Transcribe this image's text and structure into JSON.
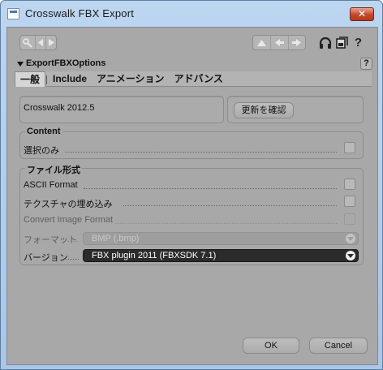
{
  "window": {
    "title": "Crosswalk FBX Export",
    "close_glyph": "✕"
  },
  "toolbar": {
    "left_icons": [
      "wrench-icon",
      "arrow-left-icon",
      "arrow-right-icon"
    ],
    "right_icons": [
      "move-up-icon",
      "move-left-icon",
      "move-right-icon",
      "headphones-icon",
      "copy-icon",
      "help-icon"
    ],
    "help_glyph": "?"
  },
  "section": {
    "title": "ExportFBXOptions",
    "help_glyph": "?"
  },
  "tabs": [
    "一般",
    "Include",
    "アニメーション",
    "アドバンス"
  ],
  "version_panel": {
    "product": "Crosswalk  2012.5",
    "check_update_label": "更新を確認"
  },
  "content_group": {
    "title": "Content",
    "selected_only_label": "選択のみ"
  },
  "file_format_group": {
    "title": "ファイル形式",
    "ascii_label": "ASCII Format",
    "embed_textures_label": "テクスチャの埋め込み",
    "convert_image_label": "Convert Image Format",
    "format_label": "フォーマット",
    "format_value": "BMP (.bmp)",
    "version_label": "バージョン",
    "version_value": "FBX plugin 2011 (FBXSDK 7.1)"
  },
  "buttons": {
    "ok": "OK",
    "cancel": "Cancel"
  }
}
